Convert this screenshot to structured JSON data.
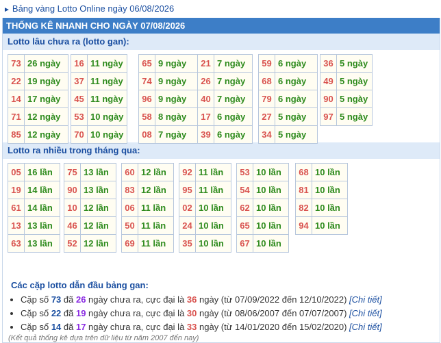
{
  "top_link": "Bảng vàng Lotto Online ngày 06/08/2026",
  "panel_title": "THỐNG KÊ NHANH CHO NGÀY 07/08/2026",
  "gan": {
    "heading": "Lotto lâu chưa ra (lotto gan):",
    "columns": [
      [
        [
          "73",
          "26 ngày"
        ],
        [
          "22",
          "19 ngày"
        ],
        [
          "14",
          "17 ngày"
        ],
        [
          "71",
          "12 ngày"
        ],
        [
          "85",
          "12 ngày"
        ]
      ],
      [
        [
          "16",
          "11 ngày"
        ],
        [
          "37",
          "11 ngày"
        ],
        [
          "45",
          "11 ngày"
        ],
        [
          "53",
          "10 ngày"
        ],
        [
          "70",
          "10 ngày"
        ]
      ],
      [
        [
          "65",
          "9 ngày"
        ],
        [
          "74",
          "9 ngày"
        ],
        [
          "96",
          "9 ngày"
        ],
        [
          "58",
          "8 ngày"
        ],
        [
          "08",
          "7 ngày"
        ]
      ],
      [
        [
          "21",
          "7 ngày"
        ],
        [
          "26",
          "7 ngày"
        ],
        [
          "40",
          "7 ngày"
        ],
        [
          "17",
          "6 ngày"
        ],
        [
          "39",
          "6 ngày"
        ]
      ],
      [
        [
          "59",
          "6 ngày"
        ],
        [
          "68",
          "6 ngày"
        ],
        [
          "79",
          "6 ngày"
        ],
        [
          "27",
          "5 ngày"
        ],
        [
          "34",
          "5 ngày"
        ]
      ],
      [
        [
          "36",
          "5 ngày"
        ],
        [
          "49",
          "5 ngày"
        ],
        [
          "90",
          "5 ngày"
        ],
        [
          "97",
          "5 ngày"
        ]
      ]
    ]
  },
  "nhieu": {
    "heading": "Lotto ra nhiều trong tháng qua:",
    "columns": [
      [
        [
          "05",
          "16 lần"
        ],
        [
          "19",
          "14 lần"
        ],
        [
          "61",
          "14 lần"
        ],
        [
          "13",
          "13 lần"
        ],
        [
          "63",
          "13 lần"
        ]
      ],
      [
        [
          "75",
          "13 lần"
        ],
        [
          "90",
          "13 lần"
        ],
        [
          "10",
          "12 lần"
        ],
        [
          "46",
          "12 lần"
        ],
        [
          "52",
          "12 lần"
        ]
      ],
      [
        [
          "60",
          "12 lần"
        ],
        [
          "83",
          "12 lần"
        ],
        [
          "06",
          "11 lần"
        ],
        [
          "50",
          "11 lần"
        ],
        [
          "69",
          "11 lần"
        ]
      ],
      [
        [
          "92",
          "11 lần"
        ],
        [
          "95",
          "11 lần"
        ],
        [
          "02",
          "10 lần"
        ],
        [
          "24",
          "10 lần"
        ],
        [
          "35",
          "10 lần"
        ]
      ],
      [
        [
          "53",
          "10 lần"
        ],
        [
          "54",
          "10 lần"
        ],
        [
          "62",
          "10 lần"
        ],
        [
          "65",
          "10 lần"
        ],
        [
          "67",
          "10 lần"
        ]
      ],
      [
        [
          "68",
          "10 lần"
        ],
        [
          "81",
          "10 lần"
        ],
        [
          "82",
          "10 lần"
        ],
        [
          "94",
          "10 lần"
        ]
      ]
    ]
  },
  "pairs": {
    "heading": "Các cặp lotto dẫn đầu bảng gan:",
    "items": [
      {
        "pre": "Cặp số ",
        "pair": "73",
        "mid1": " đã ",
        "days": "26",
        "mid2": " ngày chưa ra, cực đại là ",
        "max": "36",
        "mid3": " ngày (từ 07/09/2022 đến 12/10/2022) ",
        "detail": "[Chi tiết]"
      },
      {
        "pre": "Cặp số ",
        "pair": "22",
        "mid1": " đã ",
        "days": "19",
        "mid2": " ngày chưa ra, cực đại là ",
        "max": "30",
        "mid3": " ngày (từ 08/06/2007 đến 07/07/2007) ",
        "detail": "[Chi tiết]"
      },
      {
        "pre": "Cặp số ",
        "pair": "14",
        "mid1": " đã ",
        "days": "17",
        "mid2": " ngày chưa ra, cực đại là ",
        "max": "33",
        "mid3": " ngày (từ 14/01/2020 đến 15/02/2020) ",
        "detail": "[Chi tiết]"
      }
    ]
  },
  "note": "(Kết quả thống kê dựa trên dữ liệu từ năm 2007 đến nay)"
}
